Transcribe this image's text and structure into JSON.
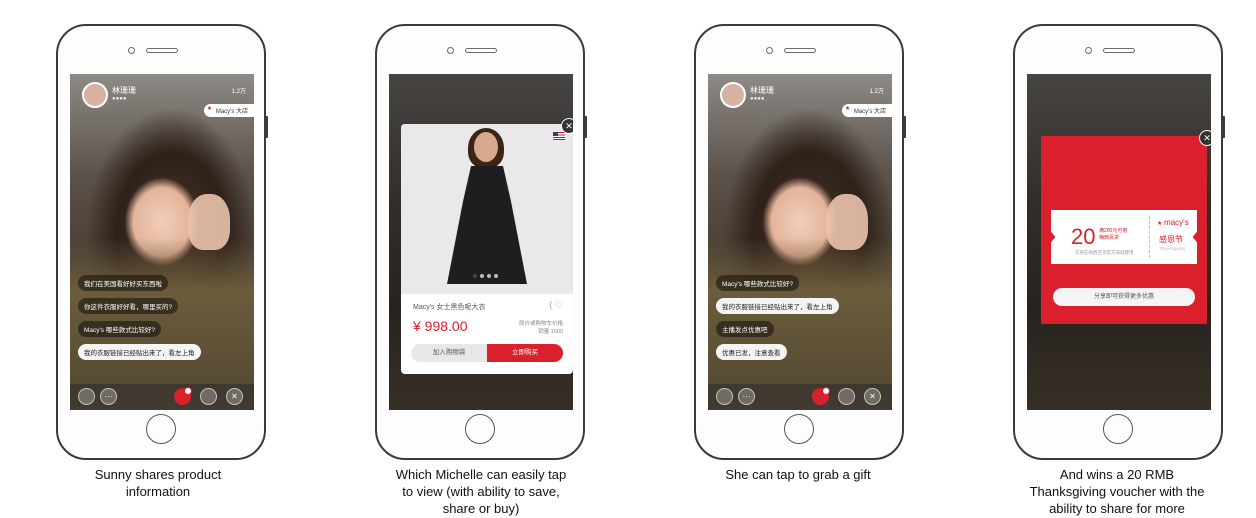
{
  "phones": [
    {
      "caption_lines": [
        "Sunny shares product",
        "information"
      ],
      "stream": {
        "host_name": "林珊珊",
        "host_sub": "●●●●",
        "viewers": "1.2万",
        "brand_tag": "Macy's 大店",
        "chat": [
          "我们在美国看好好买东西啦",
          "你这件衣服好好看，哪里买的?",
          "Macy's 哪些款式比较好?",
          "我的衣服链接已经贴出来了，看左上角"
        ]
      }
    },
    {
      "caption_lines": [
        "Which Michelle can easily tap",
        "to view (with ability to save,",
        "share or buy)"
      ],
      "product": {
        "name": "Macy's 女士黑色呢大衣",
        "price": "¥ 998.00",
        "meta_line1": "原价或购物车价格",
        "meta_line2": "销量 1000",
        "cart_label": "加入购物袋",
        "buy_label": "立即购买",
        "icons": "⟨ ♡",
        "close": "✕"
      }
    },
    {
      "caption_lines": [
        "She can tap to grab a gift"
      ],
      "stream": {
        "host_name": "林珊珊",
        "host_sub": "●●●●",
        "viewers": "1.2万",
        "brand_tag": "Macy's 大店",
        "chat": [
          "Macy's 哪些款式比较好?",
          "我的衣服链接已经贴出来了，看左上角",
          "主播发点优惠吧",
          "优惠已发，注意查看"
        ]
      }
    },
    {
      "caption_lines": [
        "And wins a 20 RMB",
        "Thanksgiving voucher with the",
        "ability to share for more"
      ],
      "voucher": {
        "amount": "20",
        "sub_line1": "满200元可用",
        "sub_line2": "梅西百货",
        "note": "仅限在梅西百货官方商城使用",
        "brand": "macy's",
        "holiday": "感恩节",
        "small": "Thanksgiving",
        "share_label": "分享即可获得更多优惠",
        "close": "✕"
      }
    }
  ],
  "colors": {
    "accent": "#d9202c"
  }
}
